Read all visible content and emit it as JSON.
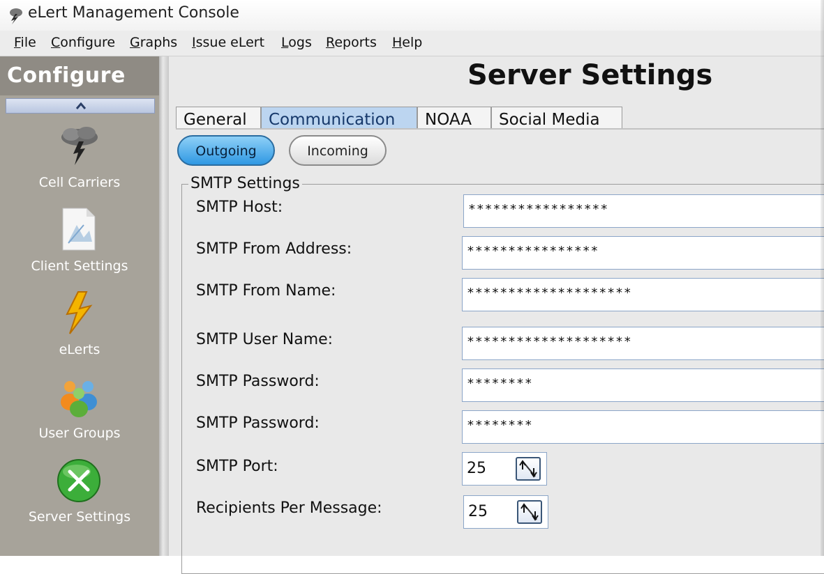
{
  "window": {
    "title": "eLert Management Console"
  },
  "menu": [
    {
      "mnemonic": "F",
      "rest": "ile"
    },
    {
      "mnemonic": "C",
      "rest": "onfigure"
    },
    {
      "mnemonic": "G",
      "rest": "raphs"
    },
    {
      "mnemonic": "I",
      "rest": "ssue eLert"
    },
    {
      "mnemonic": "L",
      "rest": "ogs"
    },
    {
      "mnemonic": "R",
      "rest": "eports"
    },
    {
      "mnemonic": "H",
      "rest": "elp"
    }
  ],
  "sidebar": {
    "title": "Configure",
    "items": [
      {
        "label": "Cell Carriers",
        "icon": "storm-cloud-icon"
      },
      {
        "label": "Client Settings",
        "icon": "document-icon"
      },
      {
        "label": "eLerts",
        "icon": "lightning-bolt-icon"
      },
      {
        "label": "User Groups",
        "icon": "users-icon"
      },
      {
        "label": "Server Settings",
        "icon": "wrench-icon"
      }
    ]
  },
  "main": {
    "title": "Server Settings",
    "tabs": [
      "General",
      "Communication",
      "NOAA",
      "Social Media"
    ],
    "active_tab": "Communication",
    "subtabs": [
      "Outgoing",
      "Incoming"
    ],
    "active_subtab": "Outgoing"
  },
  "smtp": {
    "group_title": "SMTP Settings",
    "fields": [
      {
        "label": "SMTP Host:",
        "value": "*****************"
      },
      {
        "label": "SMTP From Address:",
        "value": "****************"
      },
      {
        "label": "SMTP From Name:",
        "value": "********************"
      },
      {
        "label": "SMTP User Name:",
        "value": "********************"
      },
      {
        "label": "SMTP Password:",
        "value": "********"
      },
      {
        "label": "SMTP Password:",
        "value": "********"
      }
    ],
    "port": {
      "label": "SMTP Port:",
      "value": "25"
    },
    "recipients": {
      "label": "Recipients Per Message:",
      "value": "25"
    }
  },
  "colors": {
    "sidebar_bg": "#a7a39a",
    "active_tab": "#bcd5f0",
    "active_pill": "#2f98e3"
  }
}
